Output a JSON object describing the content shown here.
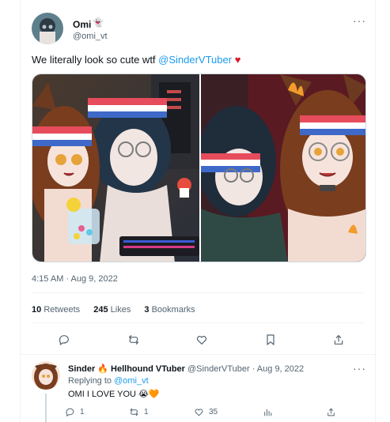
{
  "tweet": {
    "author": {
      "name": "Omi",
      "badge": "👻",
      "handle": "@omi_vt"
    },
    "text": "We literally look so cute wtf ",
    "mention": "@SinderVTuber",
    "heart": "♥",
    "images": [
      {
        "description": "two vtuber characters with headbands at a desk"
      },
      {
        "description": "two vtuber characters selfie close-up"
      }
    ],
    "timestamp": "4:15 AM · Aug 9, 2022",
    "stats": {
      "retweets_count": "10",
      "retweets_label": "Retweets",
      "likes_count": "245",
      "likes_label": "Likes",
      "bookmarks_count": "3",
      "bookmarks_label": "Bookmarks"
    },
    "more": "···"
  },
  "reply": {
    "author_name": "Sinder 🔥 Hellhound VTuber",
    "meta": "@SinderVTuber · Aug 9, 2022",
    "replying_prefix": "Replying to ",
    "replying_mention": "@omi_vt",
    "text": "OMI I LOVE YOU 😭🧡",
    "reply_count": "1",
    "retweet_count": "1",
    "like_count": "35",
    "more": "···"
  }
}
